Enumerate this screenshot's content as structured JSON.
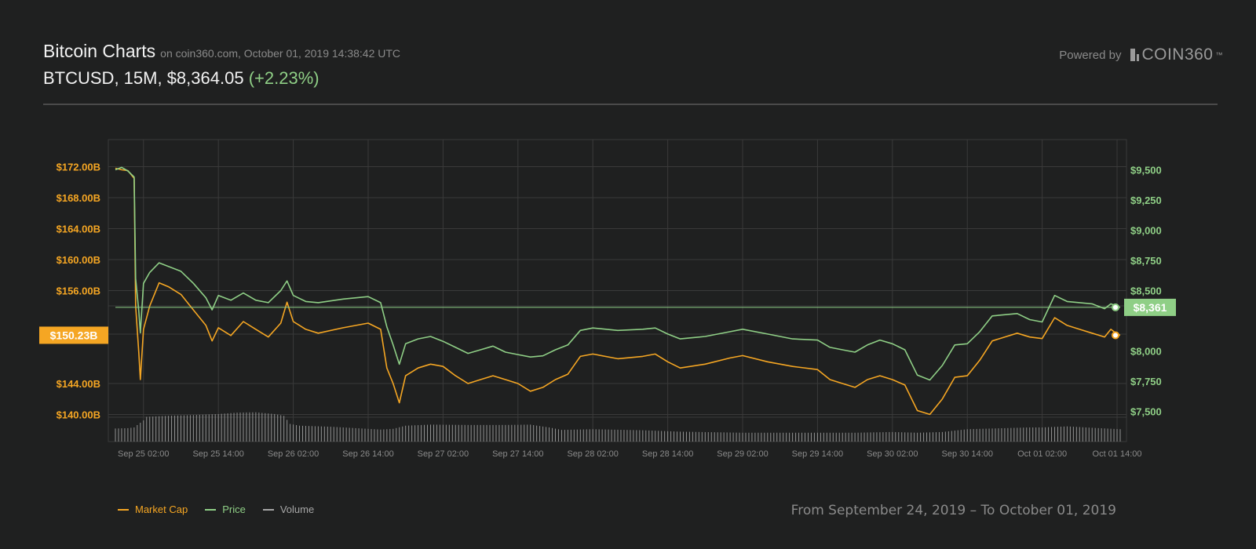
{
  "header": {
    "title": "Bitcoin Charts",
    "subtitle": "on coin360.com, October 01, 2019 14:38:42 UTC",
    "pair_info": "BTCUSD, 15M, $8,364.05",
    "change": "(+2.23%)"
  },
  "powered": {
    "label": "Powered by",
    "logo_text": "COIN360",
    "logo_tm": "™"
  },
  "range_text": "From September 24, 2019 – To October 01, 2019",
  "colors": {
    "background": "#1f2020",
    "market_cap": "#f5a623",
    "price": "#8fcf86",
    "volume": "#a6a6a6",
    "grid": "#3a3a3a"
  },
  "chart_data": {
    "type": "line",
    "x_ticks": [
      "Sep 25 02:00",
      "Sep 25 14:00",
      "Sep 26 02:00",
      "Sep 26 14:00",
      "Sep 27 02:00",
      "Sep 27 14:00",
      "Sep 28 02:00",
      "Sep 28 14:00",
      "Sep 29 02:00",
      "Sep 29 14:00",
      "Sep 30 02:00",
      "Sep 30 14:00",
      "Oct 01 02:00",
      "Oct 01 14:00"
    ],
    "x_range": [
      "Sep 24 21:30",
      "Oct 01 14:30"
    ],
    "left_axis": {
      "ticks": [
        "$172.00B",
        "$168.00B",
        "$164.00B",
        "$160.00B",
        "$156.00B",
        "$144.00B",
        "$140.00B"
      ],
      "tick_values": [
        172,
        168,
        164,
        160,
        156,
        144,
        140
      ],
      "range": [
        136.5,
        175.5
      ],
      "current_label": "$150.23B",
      "current_value": 150.23
    },
    "right_axis": {
      "ticks": [
        "$9,500",
        "$9,250",
        "$9,000",
        "$8,750",
        "$8,500",
        "$8,000",
        "$7,750",
        "$7,500"
      ],
      "tick_values": [
        9500,
        9250,
        9000,
        8750,
        8500,
        8000,
        7750,
        7500
      ],
      "range": [
        7250,
        9750
      ],
      "current_label": "$8,361",
      "current_value": 8361
    },
    "series": [
      {
        "name": "Market Cap",
        "axis": "left",
        "color": "#f5a623",
        "points": [
          [
            "Sep 24 21:30",
            171.8
          ],
          [
            "Sep 24 22:30",
            171.6
          ],
          [
            "Sep 24 23:30",
            171.5
          ],
          [
            "Sep 25 00:30",
            170.5
          ],
          [
            "Sep 25 00:45",
            154
          ],
          [
            "Sep 25 01:15",
            148
          ],
          [
            "Sep 25 01:30",
            144.5
          ],
          [
            "Sep 25 02:00",
            151
          ],
          [
            "Sep 25 03:00",
            154
          ],
          [
            "Sep 25 04:30",
            157
          ],
          [
            "Sep 25 06:00",
            156.5
          ],
          [
            "Sep 25 08:00",
            155.5
          ],
          [
            "Sep 25 10:00",
            153.5
          ],
          [
            "Sep 25 12:00",
            151.5
          ],
          [
            "Sep 25 13:00",
            149.5
          ],
          [
            "Sep 25 14:00",
            151.2
          ],
          [
            "Sep 25 16:00",
            150.2
          ],
          [
            "Sep 25 18:00",
            152
          ],
          [
            "Sep 25 20:00",
            151
          ],
          [
            "Sep 25 22:00",
            150
          ],
          [
            "Sep 26 00:00",
            151.8
          ],
          [
            "Sep 26 01:00",
            154.5
          ],
          [
            "Sep 26 02:00",
            152
          ],
          [
            "Sep 26 04:00",
            151
          ],
          [
            "Sep 26 06:00",
            150.5
          ],
          [
            "Sep 26 10:00",
            151.2
          ],
          [
            "Sep 26 14:00",
            151.8
          ],
          [
            "Sep 26 16:00",
            151
          ],
          [
            "Sep 26 17:00",
            146
          ],
          [
            "Sep 26 18:00",
            144
          ],
          [
            "Sep 26 19:00",
            141.5
          ],
          [
            "Sep 26 20:00",
            145
          ],
          [
            "Sep 26 22:00",
            146
          ],
          [
            "Sep 27 00:00",
            146.5
          ],
          [
            "Sep 27 02:00",
            146.2
          ],
          [
            "Sep 27 04:00",
            145
          ],
          [
            "Sep 27 06:00",
            144
          ],
          [
            "Sep 27 08:00",
            144.5
          ],
          [
            "Sep 27 10:00",
            145
          ],
          [
            "Sep 27 12:00",
            144.5
          ],
          [
            "Sep 27 14:00",
            144
          ],
          [
            "Sep 27 16:00",
            143
          ],
          [
            "Sep 27 18:00",
            143.5
          ],
          [
            "Sep 27 20:00",
            144.5
          ],
          [
            "Sep 27 22:00",
            145.2
          ],
          [
            "Sep 28 00:00",
            147.5
          ],
          [
            "Sep 28 02:00",
            147.8
          ],
          [
            "Sep 28 06:00",
            147.2
          ],
          [
            "Sep 28 10:00",
            147.5
          ],
          [
            "Sep 28 12:00",
            147.8
          ],
          [
            "Sep 28 14:00",
            146.8
          ],
          [
            "Sep 28 16:00",
            146
          ],
          [
            "Sep 28 20:00",
            146.5
          ],
          [
            "Sep 29 00:00",
            147.3
          ],
          [
            "Sep 29 02:00",
            147.6
          ],
          [
            "Sep 29 06:00",
            146.8
          ],
          [
            "Sep 29 10:00",
            146.2
          ],
          [
            "Sep 29 14:00",
            145.8
          ],
          [
            "Sep 29 16:00",
            144.5
          ],
          [
            "Sep 29 18:00",
            144
          ],
          [
            "Sep 29 20:00",
            143.5
          ],
          [
            "Sep 29 22:00",
            144.5
          ],
          [
            "Sep 30 00:00",
            145
          ],
          [
            "Sep 30 02:00",
            144.5
          ],
          [
            "Sep 30 04:00",
            143.8
          ],
          [
            "Sep 30 06:00",
            140.5
          ],
          [
            "Sep 30 08:00",
            140
          ],
          [
            "Sep 30 10:00",
            142
          ],
          [
            "Sep 30 12:00",
            144.8
          ],
          [
            "Sep 30 14:00",
            145
          ],
          [
            "Sep 30 16:00",
            147
          ],
          [
            "Sep 30 18:00",
            149.5
          ],
          [
            "Sep 30 22:00",
            150.5
          ],
          [
            "Oct 01 00:00",
            150
          ],
          [
            "Oct 01 02:00",
            149.8
          ],
          [
            "Oct 01 04:00",
            152.5
          ],
          [
            "Oct 01 06:00",
            151.5
          ],
          [
            "Oct 01 08:00",
            151
          ],
          [
            "Oct 01 10:00",
            150.5
          ],
          [
            "Oct 01 12:00",
            150
          ],
          [
            "Oct 01 13:00",
            151
          ],
          [
            "Oct 01 14:00",
            150.4
          ],
          [
            "Oct 01 14:30",
            150.23
          ]
        ]
      },
      {
        "name": "Price",
        "axis": "right",
        "color": "#8fcf86",
        "points": [
          [
            "Sep 24 21:30",
            9500
          ],
          [
            "Sep 24 22:30",
            9520
          ],
          [
            "Sep 24 23:30",
            9490
          ],
          [
            "Sep 25 00:30",
            9440
          ],
          [
            "Sep 25 00:45",
            8600
          ],
          [
            "Sep 25 01:15",
            8330
          ],
          [
            "Sep 25 01:30",
            8150
          ],
          [
            "Sep 25 02:00",
            8560
          ],
          [
            "Sep 25 03:00",
            8650
          ],
          [
            "Sep 25 04:30",
            8730
          ],
          [
            "Sep 25 06:00",
            8700
          ],
          [
            "Sep 25 08:00",
            8660
          ],
          [
            "Sep 25 10:00",
            8560
          ],
          [
            "Sep 25 12:00",
            8440
          ],
          [
            "Sep 25 13:00",
            8340
          ],
          [
            "Sep 25 14:00",
            8460
          ],
          [
            "Sep 25 16:00",
            8420
          ],
          [
            "Sep 25 18:00",
            8480
          ],
          [
            "Sep 25 20:00",
            8420
          ],
          [
            "Sep 25 22:00",
            8400
          ],
          [
            "Sep 26 00:00",
            8500
          ],
          [
            "Sep 26 01:00",
            8580
          ],
          [
            "Sep 26 02:00",
            8460
          ],
          [
            "Sep 26 04:00",
            8410
          ],
          [
            "Sep 26 06:00",
            8400
          ],
          [
            "Sep 26 10:00",
            8430
          ],
          [
            "Sep 26 14:00",
            8450
          ],
          [
            "Sep 26 16:00",
            8400
          ],
          [
            "Sep 26 17:00",
            8200
          ],
          [
            "Sep 26 18:00",
            8050
          ],
          [
            "Sep 26 19:00",
            7890
          ],
          [
            "Sep 26 20:00",
            8060
          ],
          [
            "Sep 26 22:00",
            8100
          ],
          [
            "Sep 27 00:00",
            8120
          ],
          [
            "Sep 27 02:00",
            8080
          ],
          [
            "Sep 27 04:00",
            8030
          ],
          [
            "Sep 27 06:00",
            7980
          ],
          [
            "Sep 27 08:00",
            8010
          ],
          [
            "Sep 27 10:00",
            8040
          ],
          [
            "Sep 27 12:00",
            7990
          ],
          [
            "Sep 27 14:00",
            7970
          ],
          [
            "Sep 27 16:00",
            7950
          ],
          [
            "Sep 27 18:00",
            7960
          ],
          [
            "Sep 27 20:00",
            8010
          ],
          [
            "Sep 27 22:00",
            8050
          ],
          [
            "Sep 28 00:00",
            8170
          ],
          [
            "Sep 28 02:00",
            8190
          ],
          [
            "Sep 28 06:00",
            8170
          ],
          [
            "Sep 28 10:00",
            8180
          ],
          [
            "Sep 28 12:00",
            8190
          ],
          [
            "Sep 28 14:00",
            8140
          ],
          [
            "Sep 28 16:00",
            8100
          ],
          [
            "Sep 28 20:00",
            8120
          ],
          [
            "Sep 29 00:00",
            8160
          ],
          [
            "Sep 29 02:00",
            8180
          ],
          [
            "Sep 29 06:00",
            8140
          ],
          [
            "Sep 29 10:00",
            8100
          ],
          [
            "Sep 29 14:00",
            8090
          ],
          [
            "Sep 29 16:00",
            8030
          ],
          [
            "Sep 29 18:00",
            8010
          ],
          [
            "Sep 29 20:00",
            7990
          ],
          [
            "Sep 29 22:00",
            8050
          ],
          [
            "Sep 30 00:00",
            8090
          ],
          [
            "Sep 30 02:00",
            8060
          ],
          [
            "Sep 30 04:00",
            8010
          ],
          [
            "Sep 30 06:00",
            7800
          ],
          [
            "Sep 30 08:00",
            7760
          ],
          [
            "Sep 30 10:00",
            7880
          ],
          [
            "Sep 30 12:00",
            8050
          ],
          [
            "Sep 30 14:00",
            8060
          ],
          [
            "Sep 30 16:00",
            8160
          ],
          [
            "Sep 30 18:00",
            8290
          ],
          [
            "Sep 30 22:00",
            8310
          ],
          [
            "Oct 01 00:00",
            8260
          ],
          [
            "Oct 01 02:00",
            8240
          ],
          [
            "Oct 01 04:00",
            8460
          ],
          [
            "Oct 01 06:00",
            8410
          ],
          [
            "Oct 01 08:00",
            8400
          ],
          [
            "Oct 01 10:00",
            8390
          ],
          [
            "Oct 01 12:00",
            8350
          ],
          [
            "Oct 01 13:00",
            8390
          ],
          [
            "Oct 01 14:00",
            8370
          ],
          [
            "Oct 01 14:30",
            8361
          ]
        ]
      },
      {
        "name": "Volume",
        "axis": "volume",
        "color": "#a6a6a6",
        "points": [
          [
            "Sep 24 21:30",
            0.37
          ],
          [
            "Sep 24 23:30",
            0.38
          ],
          [
            "Sep 25 00:30",
            0.4
          ],
          [
            "Sep 25 01:15",
            0.5
          ],
          [
            "Sep 25 02:00",
            0.6
          ],
          [
            "Sep 25 02:30",
            0.7
          ],
          [
            "Sep 25 06:00",
            0.73
          ],
          [
            "Sep 25 10:00",
            0.75
          ],
          [
            "Sep 25 14:00",
            0.78
          ],
          [
            "Sep 25 17:00",
            0.82
          ],
          [
            "Sep 25 20:00",
            0.83
          ],
          [
            "Sep 25 23:00",
            0.78
          ],
          [
            "Sep 26 00:30",
            0.73
          ],
          [
            "Sep 26 01:30",
            0.5
          ],
          [
            "Sep 26 03:00",
            0.45
          ],
          [
            "Sep 26 08:00",
            0.42
          ],
          [
            "Sep 26 12:00",
            0.38
          ],
          [
            "Sep 26 16:00",
            0.34
          ],
          [
            "Sep 26 18:00",
            0.36
          ],
          [
            "Sep 26 20:00",
            0.45
          ],
          [
            "Sep 27 00:00",
            0.48
          ],
          [
            "Sep 27 06:00",
            0.47
          ],
          [
            "Sep 27 12:00",
            0.47
          ],
          [
            "Sep 27 16:00",
            0.48
          ],
          [
            "Sep 27 19:00",
            0.4
          ],
          [
            "Sep 27 21:00",
            0.33
          ],
          [
            "Sep 28 02:00",
            0.35
          ],
          [
            "Sep 28 10:00",
            0.32
          ],
          [
            "Sep 28 16:00",
            0.28
          ],
          [
            "Sep 29 02:00",
            0.25
          ],
          [
            "Sep 29 12:00",
            0.25
          ],
          [
            "Sep 29 20:00",
            0.25
          ],
          [
            "Sep 30 02:00",
            0.27
          ],
          [
            "Sep 30 06:00",
            0.25
          ],
          [
            "Sep 30 10:00",
            0.27
          ],
          [
            "Sep 30 14:00",
            0.35
          ],
          [
            "Sep 30 20:00",
            0.38
          ],
          [
            "Oct 01 00:00",
            0.4
          ],
          [
            "Oct 01 02:00",
            0.4
          ],
          [
            "Oct 01 06:00",
            0.43
          ],
          [
            "Oct 01 10:00",
            0.39
          ],
          [
            "Oct 01 14:30",
            0.35
          ]
        ]
      }
    ],
    "legend": [
      {
        "label": "Market Cap",
        "color": "#f5a623"
      },
      {
        "label": "Price",
        "color": "#8fcf86"
      },
      {
        "label": "Volume",
        "color": "#a6a6a6"
      }
    ],
    "grid": true,
    "legend_position": "bottom-left"
  }
}
